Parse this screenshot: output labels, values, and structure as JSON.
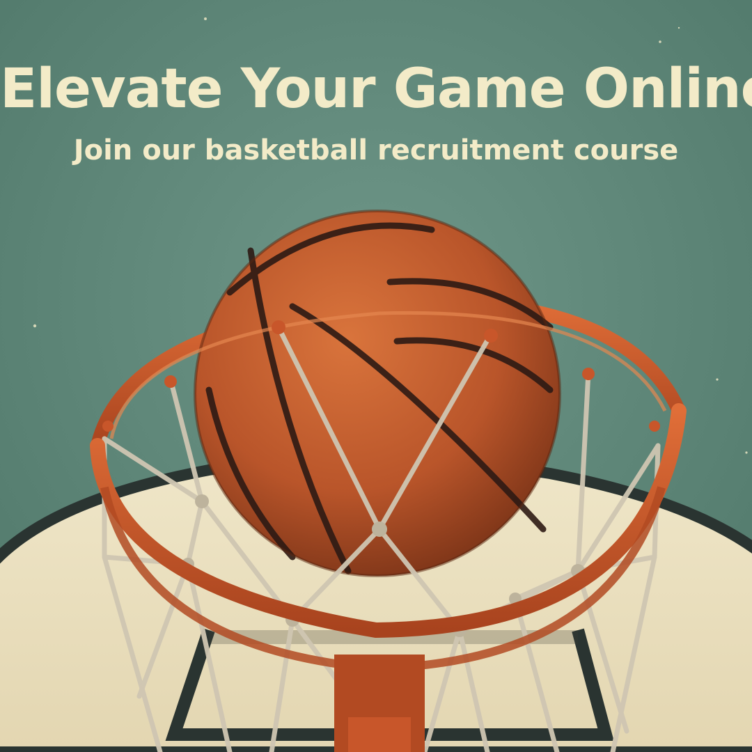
{
  "headline": {
    "title": "Elevate Your Game Online",
    "subtitle": "Join our basketball recruitment course"
  },
  "artwork": {
    "subject": "basketball-falling-through-hoop",
    "colors": {
      "sky": "#5f8a7e",
      "sky_dark": "#4f7769",
      "backboard": "#ece2c2",
      "backboard_edge": "#2a3431",
      "ball": "#c4602e",
      "ball_seam": "#2d1a14",
      "rim": "#c8562a",
      "net": "#cfc6b2",
      "text": "#f3ebc8"
    }
  }
}
